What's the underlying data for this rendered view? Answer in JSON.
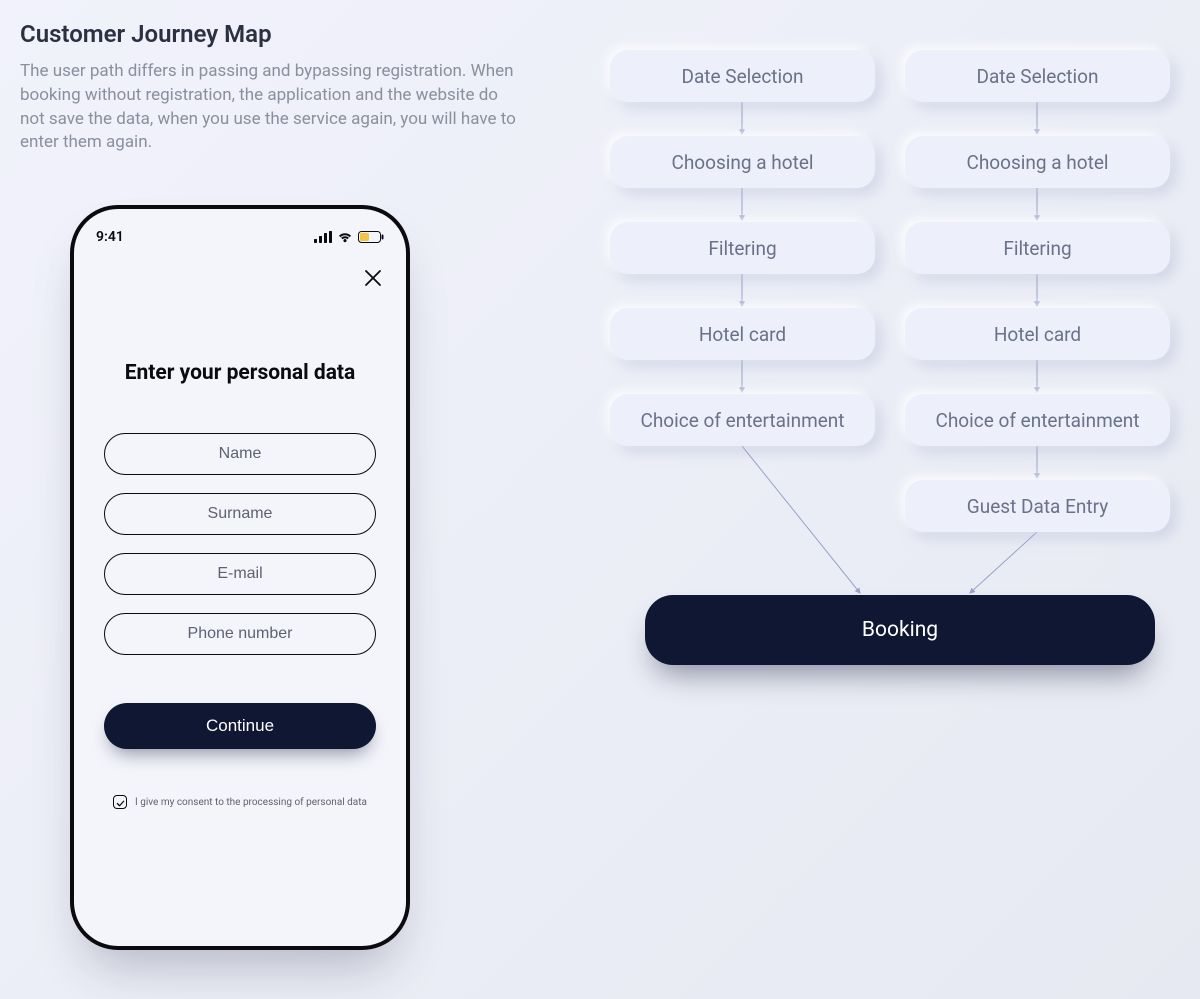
{
  "header": {
    "title": "Customer Journey Map",
    "description": "The user path differs in passing and bypassing registration. When booking without registration, the application and the website do not save the data, when you use the service again, you will have to enter them again."
  },
  "phone": {
    "status_time": "9:41",
    "form_title": "Enter your personal data",
    "fields": {
      "name_placeholder": "Name",
      "surname_placeholder": "Surname",
      "email_placeholder": "E-mail",
      "phone_placeholder": "Phone number"
    },
    "continue_label": "Continue",
    "consent_text": "I give my consent to the processing of personal data"
  },
  "flow": {
    "left": [
      "Date Selection",
      "Choosing a hotel",
      "Filtering",
      "Hotel card",
      "Choice of entertainment"
    ],
    "right": [
      "Date Selection",
      "Choosing a hotel",
      "Filtering",
      "Hotel card",
      "Choice of entertainment",
      "Guest Data Entry"
    ],
    "final": "Booking"
  },
  "colors": {
    "dark": "#0f1733",
    "step_bg": "#edeffa",
    "text_muted": "#6a7289"
  }
}
